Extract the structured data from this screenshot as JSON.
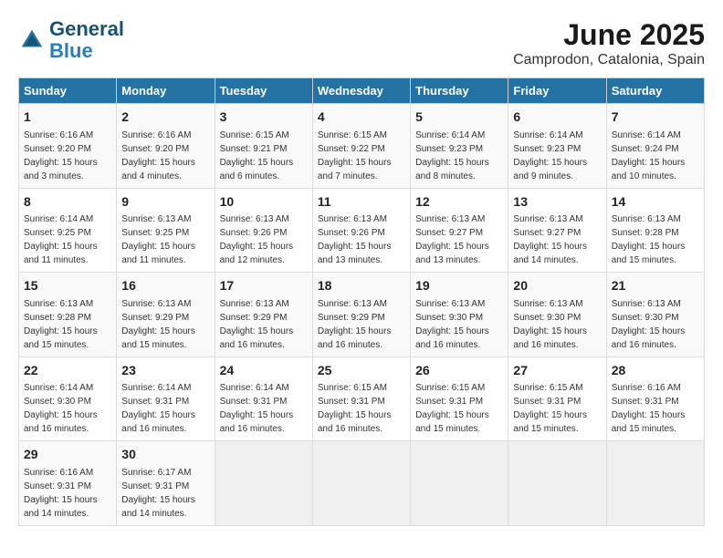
{
  "logo": {
    "line1": "General",
    "line2": "Blue"
  },
  "title": "June 2025",
  "subtitle": "Camprodon, Catalonia, Spain",
  "days_of_week": [
    "Sunday",
    "Monday",
    "Tuesday",
    "Wednesday",
    "Thursday",
    "Friday",
    "Saturday"
  ],
  "weeks": [
    [
      {
        "day": "1",
        "sunrise": "Sunrise: 6:16 AM",
        "sunset": "Sunset: 9:20 PM",
        "daylight": "Daylight: 15 hours and 3 minutes."
      },
      {
        "day": "2",
        "sunrise": "Sunrise: 6:16 AM",
        "sunset": "Sunset: 9:20 PM",
        "daylight": "Daylight: 15 hours and 4 minutes."
      },
      {
        "day": "3",
        "sunrise": "Sunrise: 6:15 AM",
        "sunset": "Sunset: 9:21 PM",
        "daylight": "Daylight: 15 hours and 6 minutes."
      },
      {
        "day": "4",
        "sunrise": "Sunrise: 6:15 AM",
        "sunset": "Sunset: 9:22 PM",
        "daylight": "Daylight: 15 hours and 7 minutes."
      },
      {
        "day": "5",
        "sunrise": "Sunrise: 6:14 AM",
        "sunset": "Sunset: 9:23 PM",
        "daylight": "Daylight: 15 hours and 8 minutes."
      },
      {
        "day": "6",
        "sunrise": "Sunrise: 6:14 AM",
        "sunset": "Sunset: 9:23 PM",
        "daylight": "Daylight: 15 hours and 9 minutes."
      },
      {
        "day": "7",
        "sunrise": "Sunrise: 6:14 AM",
        "sunset": "Sunset: 9:24 PM",
        "daylight": "Daylight: 15 hours and 10 minutes."
      }
    ],
    [
      {
        "day": "8",
        "sunrise": "Sunrise: 6:14 AM",
        "sunset": "Sunset: 9:25 PM",
        "daylight": "Daylight: 15 hours and 11 minutes."
      },
      {
        "day": "9",
        "sunrise": "Sunrise: 6:13 AM",
        "sunset": "Sunset: 9:25 PM",
        "daylight": "Daylight: 15 hours and 11 minutes."
      },
      {
        "day": "10",
        "sunrise": "Sunrise: 6:13 AM",
        "sunset": "Sunset: 9:26 PM",
        "daylight": "Daylight: 15 hours and 12 minutes."
      },
      {
        "day": "11",
        "sunrise": "Sunrise: 6:13 AM",
        "sunset": "Sunset: 9:26 PM",
        "daylight": "Daylight: 15 hours and 13 minutes."
      },
      {
        "day": "12",
        "sunrise": "Sunrise: 6:13 AM",
        "sunset": "Sunset: 9:27 PM",
        "daylight": "Daylight: 15 hours and 13 minutes."
      },
      {
        "day": "13",
        "sunrise": "Sunrise: 6:13 AM",
        "sunset": "Sunset: 9:27 PM",
        "daylight": "Daylight: 15 hours and 14 minutes."
      },
      {
        "day": "14",
        "sunrise": "Sunrise: 6:13 AM",
        "sunset": "Sunset: 9:28 PM",
        "daylight": "Daylight: 15 hours and 15 minutes."
      }
    ],
    [
      {
        "day": "15",
        "sunrise": "Sunrise: 6:13 AM",
        "sunset": "Sunset: 9:28 PM",
        "daylight": "Daylight: 15 hours and 15 minutes."
      },
      {
        "day": "16",
        "sunrise": "Sunrise: 6:13 AM",
        "sunset": "Sunset: 9:29 PM",
        "daylight": "Daylight: 15 hours and 15 minutes."
      },
      {
        "day": "17",
        "sunrise": "Sunrise: 6:13 AM",
        "sunset": "Sunset: 9:29 PM",
        "daylight": "Daylight: 15 hours and 16 minutes."
      },
      {
        "day": "18",
        "sunrise": "Sunrise: 6:13 AM",
        "sunset": "Sunset: 9:29 PM",
        "daylight": "Daylight: 15 hours and 16 minutes."
      },
      {
        "day": "19",
        "sunrise": "Sunrise: 6:13 AM",
        "sunset": "Sunset: 9:30 PM",
        "daylight": "Daylight: 15 hours and 16 minutes."
      },
      {
        "day": "20",
        "sunrise": "Sunrise: 6:13 AM",
        "sunset": "Sunset: 9:30 PM",
        "daylight": "Daylight: 15 hours and 16 minutes."
      },
      {
        "day": "21",
        "sunrise": "Sunrise: 6:13 AM",
        "sunset": "Sunset: 9:30 PM",
        "daylight": "Daylight: 15 hours and 16 minutes."
      }
    ],
    [
      {
        "day": "22",
        "sunrise": "Sunrise: 6:14 AM",
        "sunset": "Sunset: 9:30 PM",
        "daylight": "Daylight: 15 hours and 16 minutes."
      },
      {
        "day": "23",
        "sunrise": "Sunrise: 6:14 AM",
        "sunset": "Sunset: 9:31 PM",
        "daylight": "Daylight: 15 hours and 16 minutes."
      },
      {
        "day": "24",
        "sunrise": "Sunrise: 6:14 AM",
        "sunset": "Sunset: 9:31 PM",
        "daylight": "Daylight: 15 hours and 16 minutes."
      },
      {
        "day": "25",
        "sunrise": "Sunrise: 6:15 AM",
        "sunset": "Sunset: 9:31 PM",
        "daylight": "Daylight: 15 hours and 16 minutes."
      },
      {
        "day": "26",
        "sunrise": "Sunrise: 6:15 AM",
        "sunset": "Sunset: 9:31 PM",
        "daylight": "Daylight: 15 hours and 15 minutes."
      },
      {
        "day": "27",
        "sunrise": "Sunrise: 6:15 AM",
        "sunset": "Sunset: 9:31 PM",
        "daylight": "Daylight: 15 hours and 15 minutes."
      },
      {
        "day": "28",
        "sunrise": "Sunrise: 6:16 AM",
        "sunset": "Sunset: 9:31 PM",
        "daylight": "Daylight: 15 hours and 15 minutes."
      }
    ],
    [
      {
        "day": "29",
        "sunrise": "Sunrise: 6:16 AM",
        "sunset": "Sunset: 9:31 PM",
        "daylight": "Daylight: 15 hours and 14 minutes."
      },
      {
        "day": "30",
        "sunrise": "Sunrise: 6:17 AM",
        "sunset": "Sunset: 9:31 PM",
        "daylight": "Daylight: 15 hours and 14 minutes."
      },
      null,
      null,
      null,
      null,
      null
    ]
  ]
}
